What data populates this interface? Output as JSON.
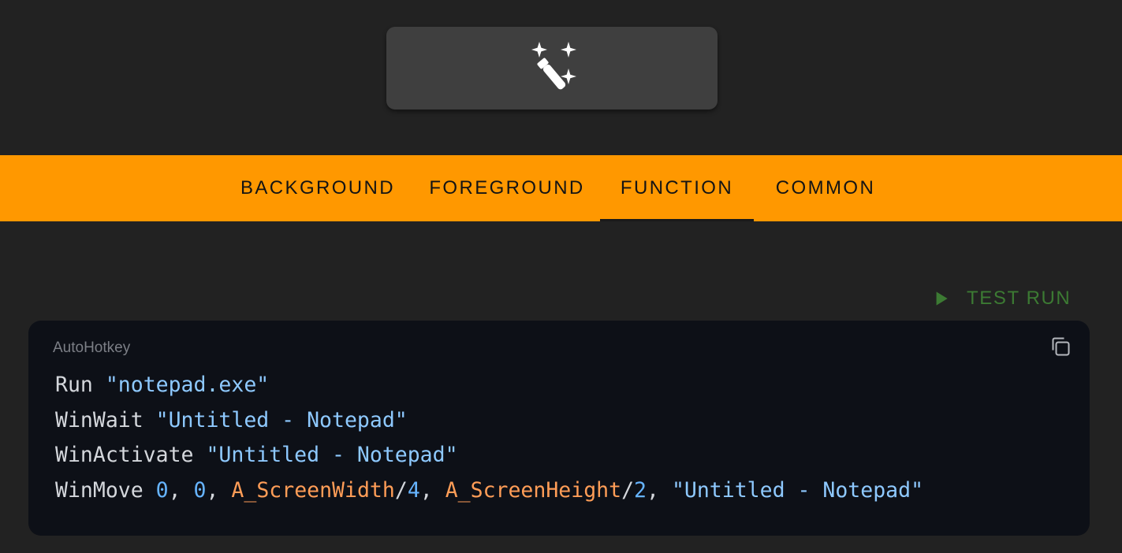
{
  "top_action": {
    "icon": "magic-wand-icon"
  },
  "tabs": [
    {
      "label": "BACKGROUND",
      "active": false
    },
    {
      "label": "FOREGROUND",
      "active": false
    },
    {
      "label": "FUNCTION",
      "active": true
    },
    {
      "label": "COMMON",
      "active": false
    }
  ],
  "test_run": {
    "label": "TEST RUN",
    "icon": "play-icon",
    "color": "#3c7a33"
  },
  "code_block": {
    "language": "AutoHotkey",
    "copy_icon": "copy-icon",
    "lines": [
      [
        {
          "text": "Run ",
          "type": "plain"
        },
        {
          "text": "\"notepad.exe\"",
          "type": "str"
        }
      ],
      [
        {
          "text": "WinWait ",
          "type": "plain"
        },
        {
          "text": "\"Untitled - Notepad\"",
          "type": "str"
        }
      ],
      [
        {
          "text": "WinActivate ",
          "type": "plain"
        },
        {
          "text": "\"Untitled - Notepad\"",
          "type": "str"
        }
      ],
      [
        {
          "text": "WinMove ",
          "type": "plain"
        },
        {
          "text": "0",
          "type": "num"
        },
        {
          "text": ", ",
          "type": "plain"
        },
        {
          "text": "0",
          "type": "num"
        },
        {
          "text": ", ",
          "type": "plain"
        },
        {
          "text": "A_ScreenWidth",
          "type": "var"
        },
        {
          "text": "/",
          "type": "plain"
        },
        {
          "text": "4",
          "type": "num"
        },
        {
          "text": ", ",
          "type": "plain"
        },
        {
          "text": "A_ScreenHeight",
          "type": "var"
        },
        {
          "text": "/",
          "type": "plain"
        },
        {
          "text": "2",
          "type": "num"
        },
        {
          "text": ", ",
          "type": "plain"
        },
        {
          "text": "\"Untitled - Notepad\"",
          "type": "str"
        }
      ]
    ]
  },
  "colors": {
    "background": "#222222",
    "tabbar": "#ff9800",
    "code_background": "#0d1017",
    "string": "#8ec9ff",
    "number": "#66b4ff",
    "variable": "#ff9d57"
  }
}
